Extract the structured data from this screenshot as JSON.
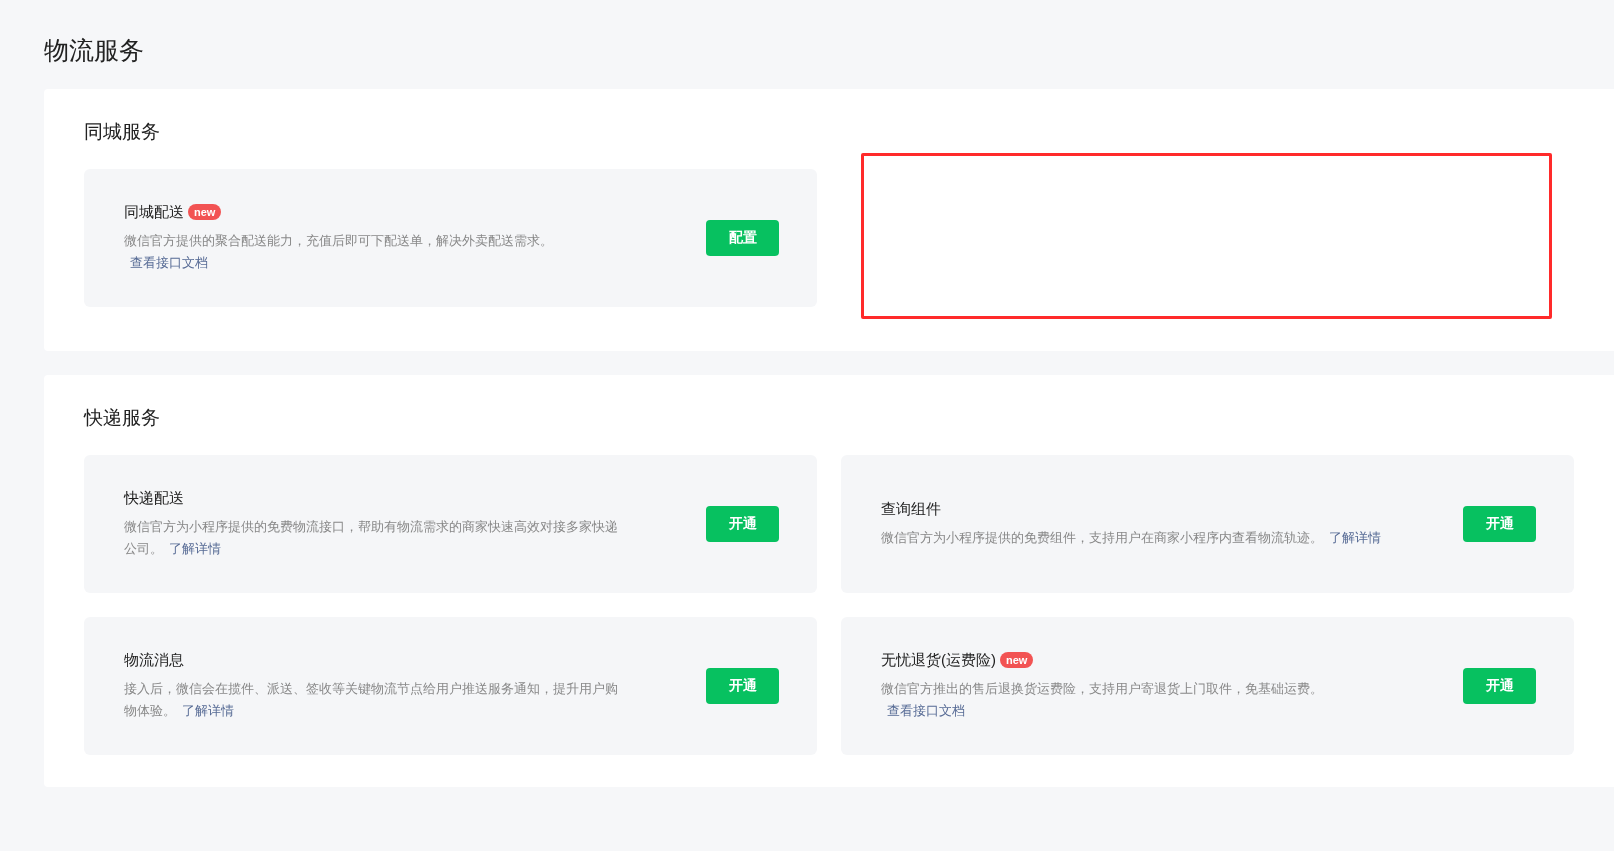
{
  "page_title": "物流服务",
  "sections": [
    {
      "title": "同城服务",
      "annotation_box": true,
      "services": [
        {
          "name": "同城配送",
          "badge": "new",
          "description": "微信官方提供的聚合配送能力，充值后即可下配送单，解决外卖配送需求。",
          "link": "查看接口文档",
          "button": "配置"
        }
      ]
    },
    {
      "title": "快递服务",
      "annotation_box": false,
      "services": [
        {
          "name": "快递配送",
          "description": "微信官方为小程序提供的免费物流接口，帮助有物流需求的商家快速高效对接多家快递公司。",
          "link": "了解详情",
          "button": "开通"
        },
        {
          "name": "查询组件",
          "description": "微信官方为小程序提供的免费组件，支持用户在商家小程序内查看物流轨迹。",
          "link": "了解详情",
          "button": "开通"
        },
        {
          "name": "物流消息",
          "description": "接入后，微信会在揽件、派送、签收等关键物流节点给用户推送服务通知，提升用户购物体验。",
          "link": "了解详情",
          "button": "开通"
        },
        {
          "name": "无忧退货(运费险)",
          "badge": "new",
          "description": "微信官方推出的售后退换货运费险，支持用户寄退货上门取件，免基础运费。",
          "link": "查看接口文档",
          "button": "开通"
        }
      ]
    }
  ]
}
